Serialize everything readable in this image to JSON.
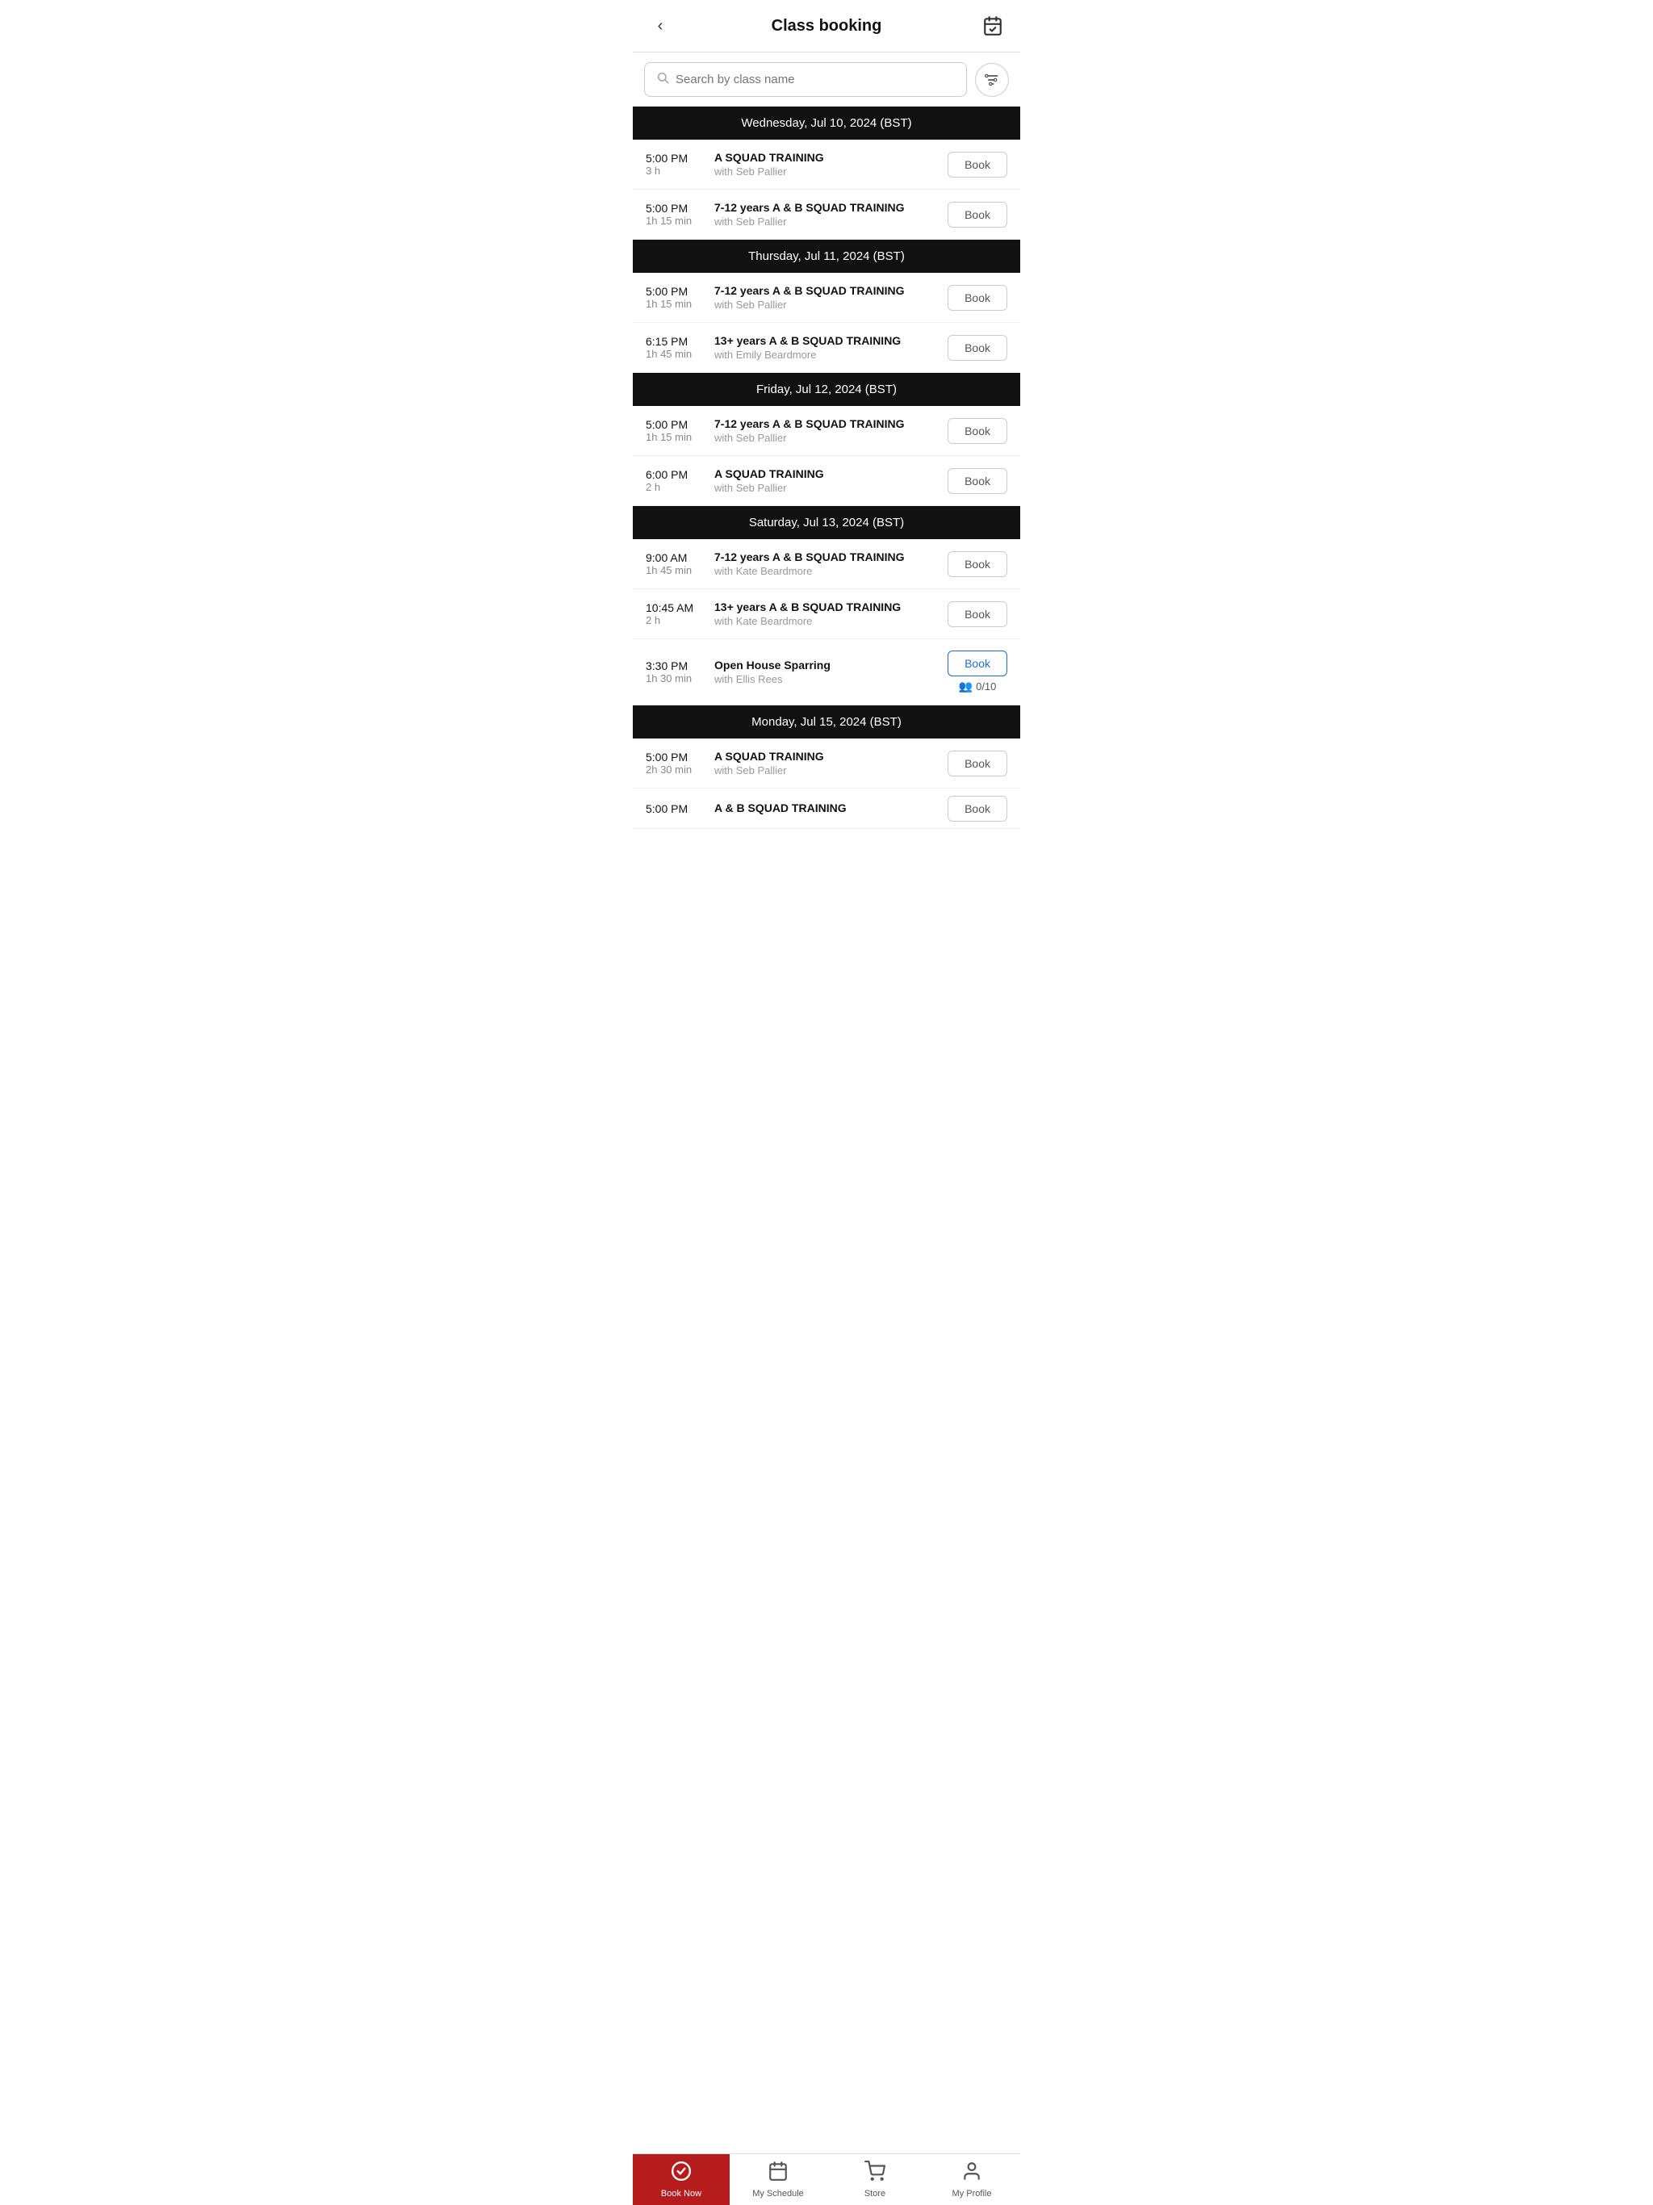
{
  "header": {
    "title": "Class booking",
    "back_label": "‹",
    "calendar_icon": "📅"
  },
  "search": {
    "placeholder": "Search by class name"
  },
  "days": [
    {
      "label": "Wednesday, Jul 10, 2024 (BST)",
      "classes": [
        {
          "time": "5:00 PM",
          "duration": "3 h",
          "name": "A SQUAD TRAINING",
          "instructor": "with Seb Pallier",
          "book_label": "Book",
          "active": false,
          "capacity": null
        },
        {
          "time": "5:00 PM",
          "duration": "1h 15 min",
          "name": "7-12 years A & B SQUAD TRAINING",
          "instructor": "with Seb Pallier",
          "book_label": "Book",
          "active": false,
          "capacity": null
        }
      ]
    },
    {
      "label": "Thursday, Jul 11, 2024 (BST)",
      "classes": [
        {
          "time": "5:00 PM",
          "duration": "1h 15 min",
          "name": "7-12 years A & B SQUAD TRAINING",
          "instructor": "with Seb Pallier",
          "book_label": "Book",
          "active": false,
          "capacity": null
        },
        {
          "time": "6:15 PM",
          "duration": "1h 45 min",
          "name": "13+ years A & B SQUAD TRAINING",
          "instructor": "with Emily Beardmore",
          "book_label": "Book",
          "active": false,
          "capacity": null
        }
      ]
    },
    {
      "label": "Friday, Jul 12, 2024 (BST)",
      "classes": [
        {
          "time": "5:00 PM",
          "duration": "1h 15 min",
          "name": "7-12 years A & B SQUAD TRAINING",
          "instructor": "with Seb Pallier",
          "book_label": "Book",
          "active": false,
          "capacity": null
        },
        {
          "time": "6:00 PM",
          "duration": "2 h",
          "name": "A SQUAD TRAINING",
          "instructor": "with Seb Pallier",
          "book_label": "Book",
          "active": false,
          "capacity": null
        }
      ]
    },
    {
      "label": "Saturday, Jul 13, 2024 (BST)",
      "classes": [
        {
          "time": "9:00 AM",
          "duration": "1h 45 min",
          "name": "7-12 years A & B SQUAD TRAINING",
          "instructor": "with Kate Beardmore",
          "book_label": "Book",
          "active": false,
          "capacity": null
        },
        {
          "time": "10:45 AM",
          "duration": "2 h",
          "name": "13+ years A & B SQUAD TRAINING",
          "instructor": "with Kate Beardmore",
          "book_label": "Book",
          "active": false,
          "capacity": null
        },
        {
          "time": "3:30 PM",
          "duration": "1h 30 min",
          "name": "Open House Sparring",
          "instructor": "with Ellis Rees",
          "book_label": "Book",
          "active": true,
          "capacity": "0/10"
        }
      ]
    },
    {
      "label": "Monday, Jul 15, 2024 (BST)",
      "classes": [
        {
          "time": "5:00 PM",
          "duration": "2h 30 min",
          "name": "A SQUAD TRAINING",
          "instructor": "with Seb Pallier",
          "book_label": "Book",
          "active": false,
          "capacity": null
        },
        {
          "time": "5:00 PM",
          "duration": "...",
          "name": "A & B SQUAD TRAINING",
          "instructor": "",
          "book_label": "Book",
          "active": false,
          "capacity": null,
          "partial": true
        }
      ]
    }
  ],
  "bottom_nav": [
    {
      "label": "Book Now",
      "icon": "✓",
      "active": true
    },
    {
      "label": "My Schedule",
      "icon": "📅",
      "active": false
    },
    {
      "label": "Store",
      "icon": "🛒",
      "active": false
    },
    {
      "label": "My Profile",
      "icon": "👤",
      "active": false
    }
  ]
}
